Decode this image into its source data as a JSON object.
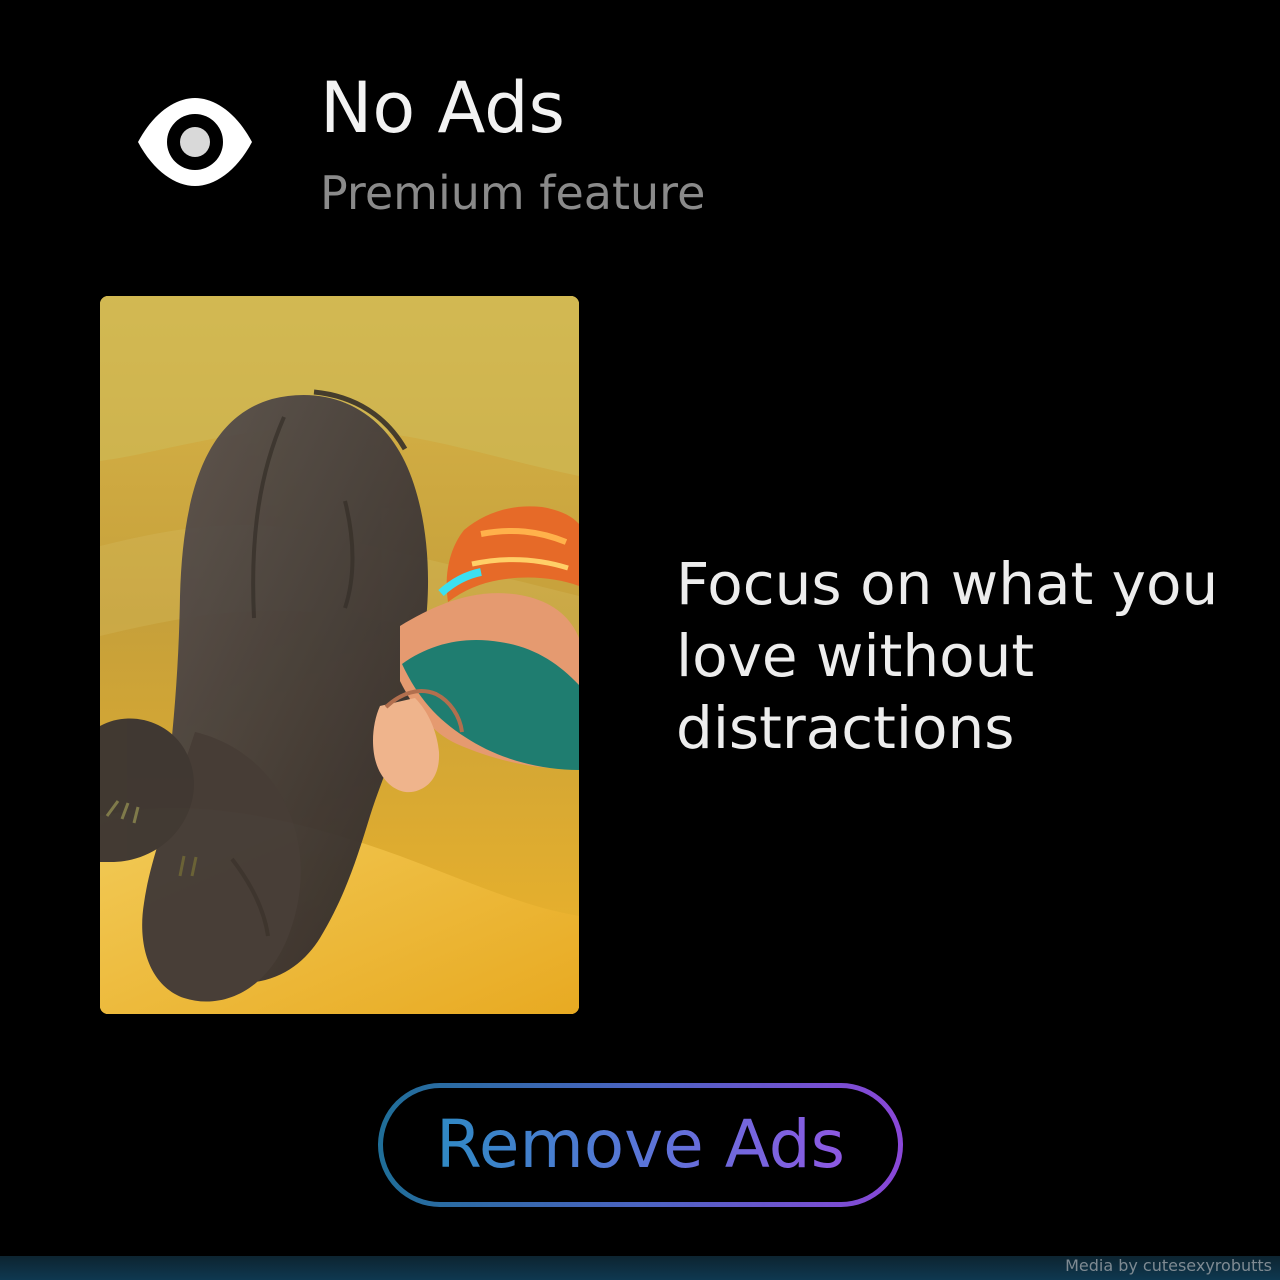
{
  "header": {
    "icon": "eye-icon",
    "title": "No Ads",
    "subtitle": "Premium feature"
  },
  "media": {
    "description": "Illustrated artwork card"
  },
  "description": "Focus on what you love without distractions",
  "cta": {
    "label": "Remove Ads"
  },
  "footer": {
    "credit": "Media by cutesexyrobutts"
  },
  "colors": {
    "background": "#000000",
    "title": "#f2f2f2",
    "subtitle": "#8a8a8a",
    "body_text": "#ededed",
    "gradient_start": "#1f6e98",
    "gradient_mid": "#4d63c3",
    "gradient_end": "#8a47d8"
  }
}
